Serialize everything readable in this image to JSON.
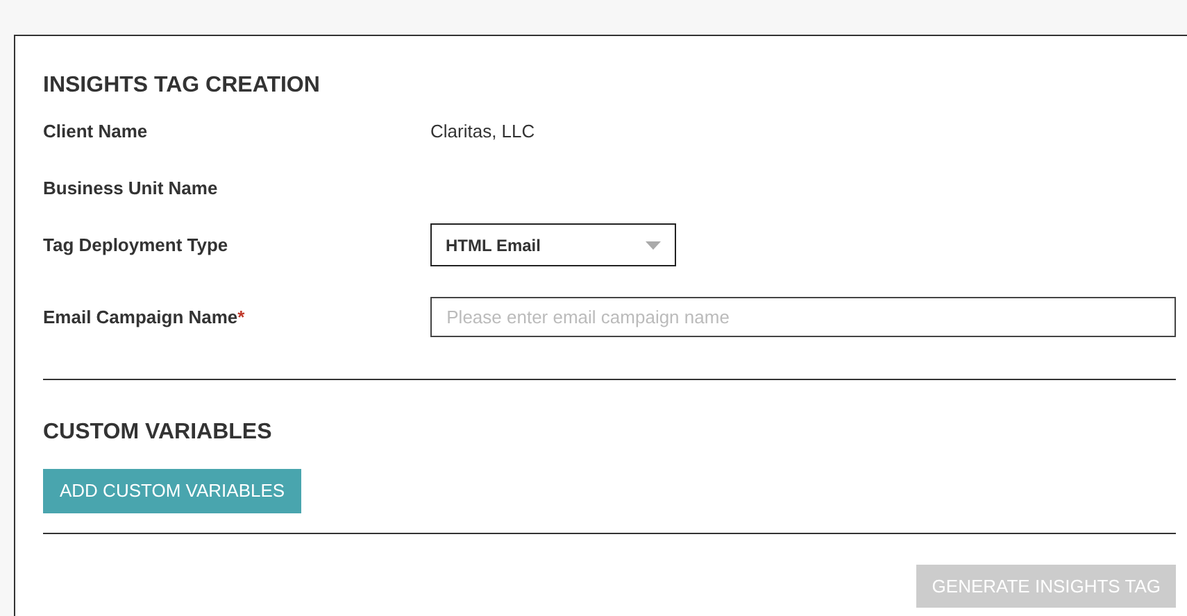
{
  "title": "INSIGHTS TAG CREATION",
  "fields": [
    {
      "kind": "text",
      "label": "Client Name",
      "value": "Claritas, LLC"
    },
    {
      "kind": "text",
      "label": "Business Unit Name"
    },
    {
      "kind": "select",
      "label": "Tag Deployment Type",
      "value": "HTML Email"
    },
    {
      "kind": "input",
      "label": "Email Campaign Name",
      "required": true,
      "required_mark": "*",
      "placeholder": "Please enter email campaign name"
    }
  ],
  "custom_variables": {
    "title": "CUSTOM VARIABLES",
    "button": "ADD CUSTOM VARIABLES"
  },
  "generate_button": {
    "label": "GENERATE INSIGHTS TAG",
    "disabled": true
  }
}
